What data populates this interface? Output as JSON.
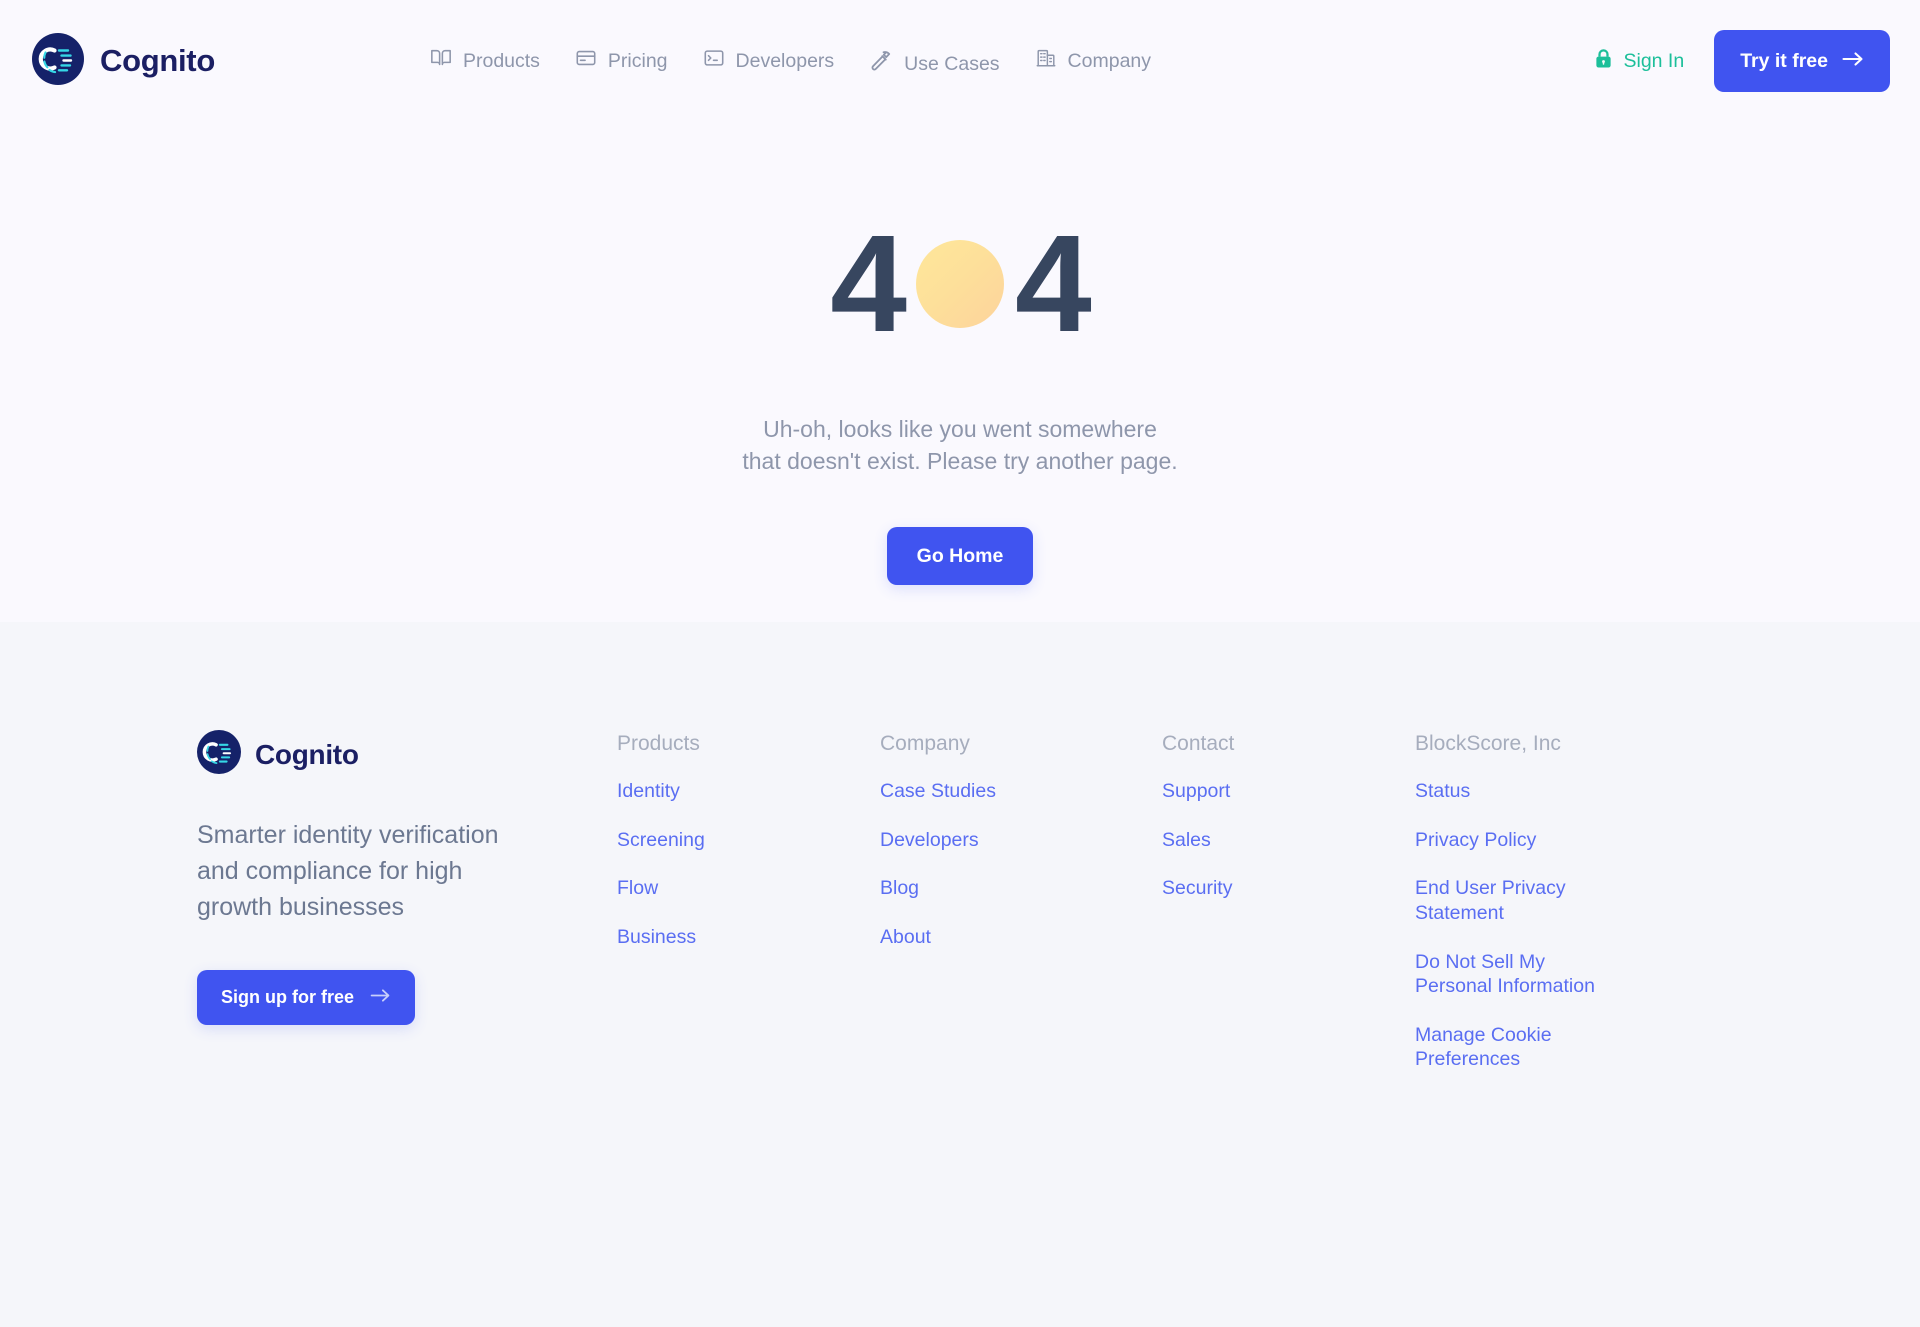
{
  "brand": {
    "name": "Cognito",
    "logo_icon": "cognito-circle-logo"
  },
  "header": {
    "nav": [
      {
        "label": "Products",
        "icon": "book-icon"
      },
      {
        "label": "Pricing",
        "icon": "credit-card-icon"
      },
      {
        "label": "Developers",
        "icon": "terminal-icon"
      },
      {
        "label": "Use Cases",
        "icon": "hammer-icon"
      },
      {
        "label": "Company",
        "icon": "office-building-icon"
      }
    ],
    "sign_in": {
      "label": "Sign In",
      "icon": "lock-icon",
      "color": "#1cbf9a"
    },
    "cta": {
      "label": "Try it free",
      "icon": "arrow-right-icon",
      "color": "#4054f0"
    }
  },
  "hero": {
    "code_left": "4",
    "code_right": "4",
    "code_circle_icon": "yellow-circle-zero",
    "message": "Uh-oh, looks like you went somewhere that doesn't exist. Please try another page.",
    "message_line_1": "Uh-oh, looks like you went somewhere",
    "message_line_2": "that doesn't exist. Please try another page.",
    "button": {
      "label": "Go Home"
    }
  },
  "footer": {
    "brand_name": "Cognito",
    "tagline": "Smarter identity verification and compliance for high growth businesses",
    "cta": {
      "label": "Sign up for free",
      "icon": "arrow-right-icon"
    },
    "columns": [
      {
        "heading": "Products",
        "links": [
          "Identity",
          "Screening",
          "Flow",
          "Business"
        ]
      },
      {
        "heading": "Company",
        "links": [
          "Case Studies",
          "Developers",
          "Blog",
          "About"
        ]
      },
      {
        "heading": "Contact",
        "links": [
          "Support",
          "Sales",
          "Security"
        ]
      },
      {
        "heading": "BlockScore, Inc",
        "links": [
          "Status",
          "Privacy Policy",
          "End User Privacy Statement",
          "Do Not Sell My Personal Information",
          "Manage Cookie Preferences"
        ]
      }
    ]
  },
  "colors": {
    "page_bg": "#faf9fe",
    "footer_bg": "#f5f6fa",
    "accent": "#4054f0",
    "link": "#5a6ef2",
    "brand_navy": "#1b1f63",
    "muted": "#8e96ab",
    "teal": "#1cbf9a",
    "error_digit": "#37465f",
    "error_circle": "#fde09a"
  }
}
